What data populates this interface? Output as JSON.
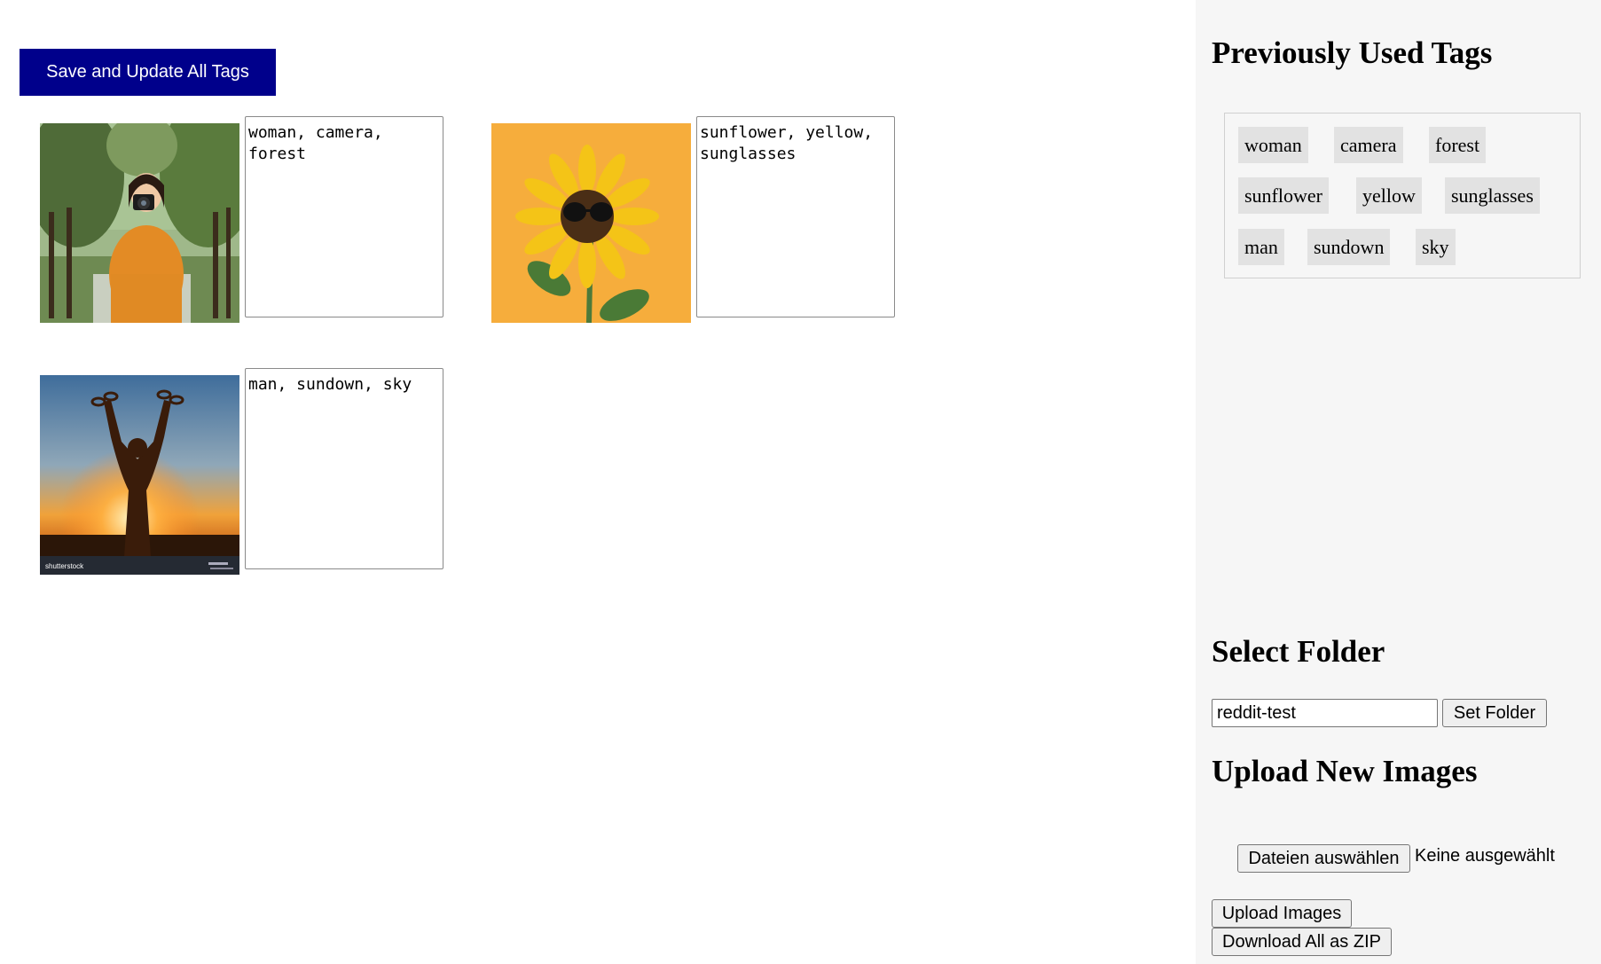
{
  "toolbar": {
    "save_label": "Save and Update All Tags"
  },
  "images": [
    {
      "alt": "woman with camera in forest",
      "tags": "woman, camera, forest"
    },
    {
      "alt": "sunflower with sunglasses",
      "tags": "sunflower, yellow, sunglasses"
    },
    {
      "alt": "man at sundown",
      "tags": "man, sundown, sky"
    }
  ],
  "sidebar": {
    "tags_heading": "Previously Used Tags",
    "tags": [
      "woman",
      "camera",
      "forest",
      "sunflower",
      "yellow",
      "sunglasses",
      "man",
      "sundown",
      "sky"
    ],
    "folder_heading": "Select Folder",
    "folder_value": "reddit-test",
    "set_folder_label": "Set Folder",
    "upload_heading": "Upload New Images",
    "choose_files_label": "Dateien auswählen",
    "no_file_label": "Keine ausgewählt",
    "upload_button_label": "Upload Images",
    "download_button_label": "Download All as ZIP"
  },
  "colors": {
    "save_button_bg": "#00008b",
    "sidebar_bg": "#f6f6f6",
    "chip_bg": "#e2e2e2"
  },
  "image3_watermark": "shutterstock"
}
